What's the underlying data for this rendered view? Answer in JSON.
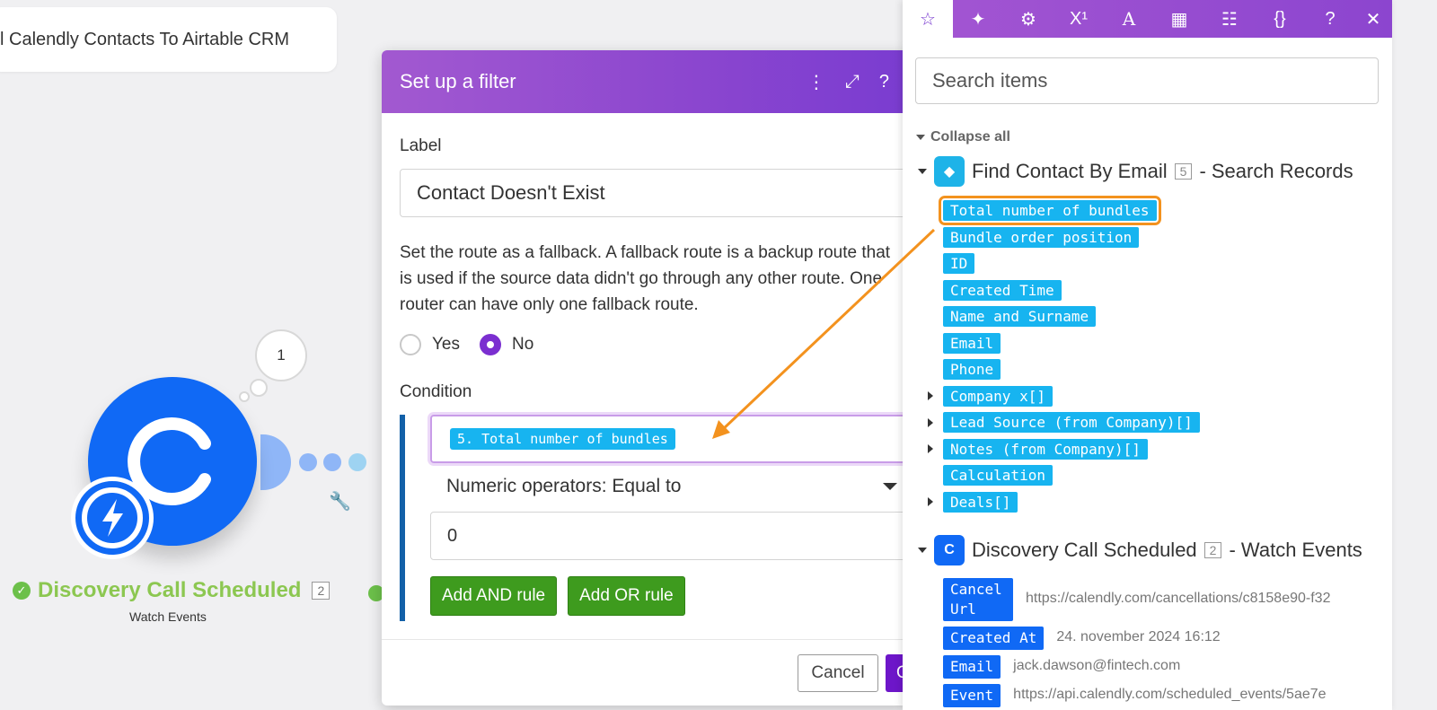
{
  "scenario": {
    "title": "l Calendly Contacts To Airtable CRM"
  },
  "canvas": {
    "bubble_count": "1",
    "module_name": "Discovery Call Scheduled",
    "module_badge": "2",
    "module_sub": "Watch Events"
  },
  "dialog": {
    "title": "Set up a filter",
    "label_caption": "Label",
    "label_value": "Contact Doesn't Exist",
    "help": "Set the route as a fallback. A fallback route is a backup route that is used if the source data didn't go through any other route. One router can have only one fallback route.",
    "radio_yes": "Yes",
    "radio_no": "No",
    "condition_caption": "Condition",
    "condition_tag": "5. Total number of bundles",
    "operator": "Numeric operators: Equal to",
    "value": "0",
    "add_and": "Add AND rule",
    "add_or": "Add OR rule",
    "cancel": "Cancel",
    "ok": "O"
  },
  "panel": {
    "search_placeholder": "Search items",
    "collapse_all": "Collapse all",
    "group1": {
      "name": "Find Contact By Email",
      "badge": "5",
      "suffix": "- Search Records",
      "items": [
        "Total number of bundles",
        "Bundle order position",
        "ID",
        "Created Time",
        "Name and Surname",
        "Email",
        "Phone",
        "Company x[]",
        "Lead Source (from Company)[]",
        "Notes (from Company)[]",
        "Calculation",
        "Deals[]"
      ]
    },
    "group2": {
      "name": "Discovery Call Scheduled",
      "badge": "2",
      "suffix": "- Watch Events",
      "rows": [
        {
          "label": "Cancel Url",
          "value": "https://calendly.com/cancellations/c8158e90-f32"
        },
        {
          "label": "Created At",
          "value": "24. november 2024 16:12"
        },
        {
          "label": "Email",
          "value": "jack.dawson@fintech.com"
        },
        {
          "label": "Event",
          "value": "https://api.calendly.com/scheduled_events/5ae7e"
        }
      ]
    }
  },
  "colors": {
    "accent": "#8b46cf",
    "tag": "#17b4f0",
    "calendly": "#1069f5",
    "highlight": "#f3921e",
    "green": "#3e9b1e"
  }
}
